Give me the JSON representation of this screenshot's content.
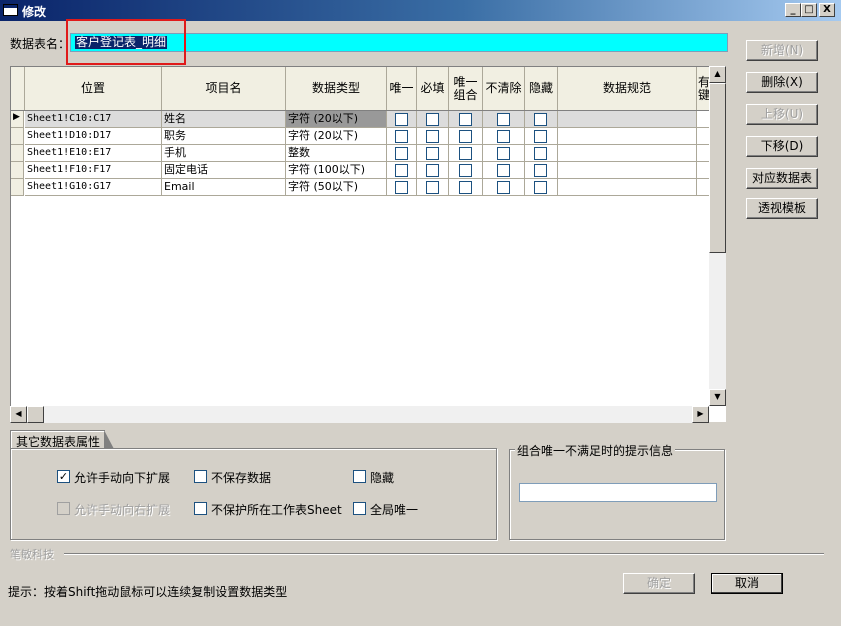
{
  "window": {
    "title": "修改",
    "min_glyph": "_",
    "max_glyph": "□",
    "close_glyph": "X"
  },
  "table_name": {
    "label": "数据表名：",
    "value": "客户登记表_明细"
  },
  "columns": [
    "位置",
    "项目名",
    "数据类型",
    "唯一",
    "必填",
    "唯一组合",
    "不清除",
    "隐藏",
    "数据规范",
    "有键"
  ],
  "rows": [
    {
      "position": "Sheet1!C10:C17",
      "item": "姓名",
      "type": "字符 (20以下)",
      "selected": true
    },
    {
      "position": "Sheet1!D10:D17",
      "item": "职务",
      "type": "字符 (20以下)"
    },
    {
      "position": "Sheet1!E10:E17",
      "item": "手机",
      "type": "整数"
    },
    {
      "position": "Sheet1!F10:F17",
      "item": "固定电话",
      "type": "字符 (100以下)"
    },
    {
      "position": "Sheet1!G10:G17",
      "item": "Email",
      "type": "字符 (50以下)"
    }
  ],
  "buttons": {
    "add": "新增(N)",
    "delete": "删除(X)",
    "move_up": "上移(U)",
    "move_down": "下移(D)",
    "map_table": "对应数据表",
    "pivot": "透视模板",
    "ok": "确定",
    "cancel": "取消"
  },
  "props": {
    "tab": "其它数据表属性",
    "allow_down": "允许手动向下扩展",
    "allow_down_checked": true,
    "allow_right": "允许手动向右扩展",
    "no_save": "不保存数据",
    "no_protect": "不保护所在工作表Sheet",
    "hidden": "隐藏",
    "global_unique": "全局唯一"
  },
  "combo_msg": {
    "label": "组合唯一不满足时的提示信息",
    "value": ""
  },
  "company": "笔敏科技",
  "hint": "提示：按着Shift拖动鼠标可以连续复制设置数据类型",
  "icons": {
    "row_pointer": "▶",
    "scroll_up": "▲",
    "scroll_down": "▼",
    "scroll_left": "◀",
    "scroll_right": "▶",
    "check": "✓"
  }
}
